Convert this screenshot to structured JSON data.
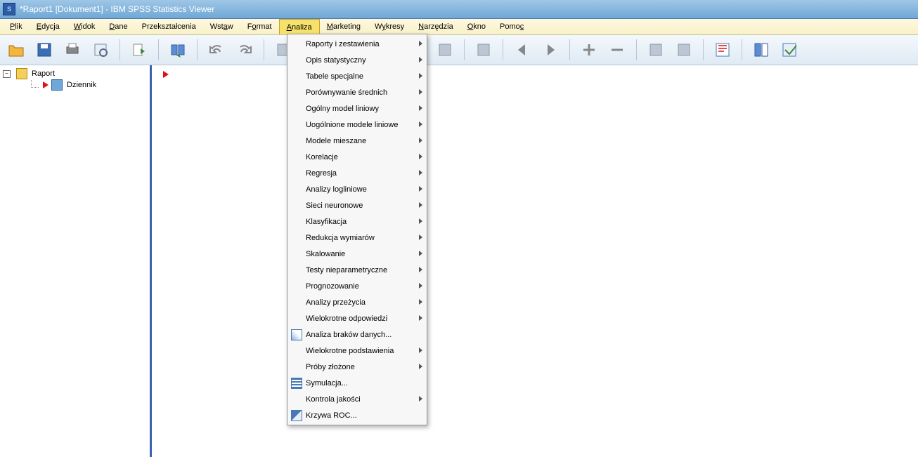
{
  "window": {
    "title": "*Raport1 [Dokument1] - IBM SPSS Statistics Viewer"
  },
  "menu": {
    "items": [
      {
        "label": "Plik",
        "u": "P"
      },
      {
        "label": "Edycja",
        "u": "E"
      },
      {
        "label": "Widok",
        "u": "W"
      },
      {
        "label": "Dane",
        "u": "D"
      },
      {
        "label": "Przekształcenia",
        "u": ""
      },
      {
        "label": "Wstaw",
        "u": "a"
      },
      {
        "label": "Format",
        "u": "o"
      },
      {
        "label": "Analiza",
        "u": "A",
        "active": true
      },
      {
        "label": "Marketing",
        "u": "M"
      },
      {
        "label": "Wykresy",
        "u": "y"
      },
      {
        "label": "Narzędzia",
        "u": "N"
      },
      {
        "label": "Okno",
        "u": "O"
      },
      {
        "label": "Pomoc",
        "u": "c"
      }
    ]
  },
  "dropdown": {
    "items": [
      {
        "label": "Raporty i zestawienia",
        "u": "i",
        "sub": true
      },
      {
        "label": "Opis statystyczny",
        "u": "O",
        "sub": true
      },
      {
        "label": "Tabele specjalne",
        "u": "T",
        "sub": true
      },
      {
        "label": "Porównywanie średnich",
        "u": "P",
        "sub": true
      },
      {
        "label": "Ogólny model liniowy",
        "u": "m",
        "sub": true
      },
      {
        "label": "Uogólnione modele liniowe",
        "u": "U",
        "sub": true
      },
      {
        "label": "Modele mieszane",
        "u": "e",
        "sub": true
      },
      {
        "label": "Korelacje",
        "u": "K",
        "sub": true
      },
      {
        "label": "Regresja",
        "u": "R",
        "sub": true
      },
      {
        "label": "Analizy logliniowe",
        "u": "",
        "sub": true
      },
      {
        "label": "Sieci neuronowe",
        "u": "",
        "sub": true
      },
      {
        "label": "Klasyfikacja",
        "u": "l",
        "sub": true
      },
      {
        "label": "Redukcja wymiarów",
        "u": "",
        "sub": true
      },
      {
        "label": "Skalowanie",
        "u": "S",
        "sub": true
      },
      {
        "label": "Testy nieparametryczne",
        "u": "n",
        "sub": true
      },
      {
        "label": "Prognozowanie",
        "u": "",
        "sub": true
      },
      {
        "label": "Analizy przeżycia",
        "u": "ż",
        "sub": true
      },
      {
        "label": "Wielokrotne odpowiedzi",
        "u": "W",
        "sub": true
      },
      {
        "label": "Analiza braków danych...",
        "u": "b",
        "icon": "ico1"
      },
      {
        "label": "Wielokrotne podstawienia",
        "u": "W",
        "sub": true
      },
      {
        "label": "Próby złożone",
        "u": "z",
        "sub": true
      },
      {
        "label": "Symulacja...",
        "u": "y",
        "icon": "ico2"
      },
      {
        "label": "Kontrola jakości",
        "u": "j",
        "sub": true
      },
      {
        "label": "Krzywa ROC...",
        "u": "",
        "icon": "ico3"
      }
    ]
  },
  "outline": {
    "root": "Raport",
    "child": "Dziennik"
  },
  "toolbar": {
    "buttons": [
      "open-icon",
      "save-icon",
      "print-icon",
      "print-preview-icon",
      "",
      "export-icon",
      "",
      "dialog-recall-icon",
      "",
      "undo-icon",
      "redo-icon",
      "",
      "run-icon-1",
      "run-icon-2",
      "",
      "chart-icon",
      "",
      "goto-data-icon",
      "goto-case-icon",
      "variables-icon",
      "",
      "pivot-icon",
      "",
      "back-icon",
      "forward-icon",
      "",
      "zoom-in-icon",
      "zoom-out-icon",
      "",
      "find-icon",
      "goto-icon",
      "",
      "designate-window-icon",
      "",
      "split-icon",
      "toggle-icon"
    ]
  }
}
